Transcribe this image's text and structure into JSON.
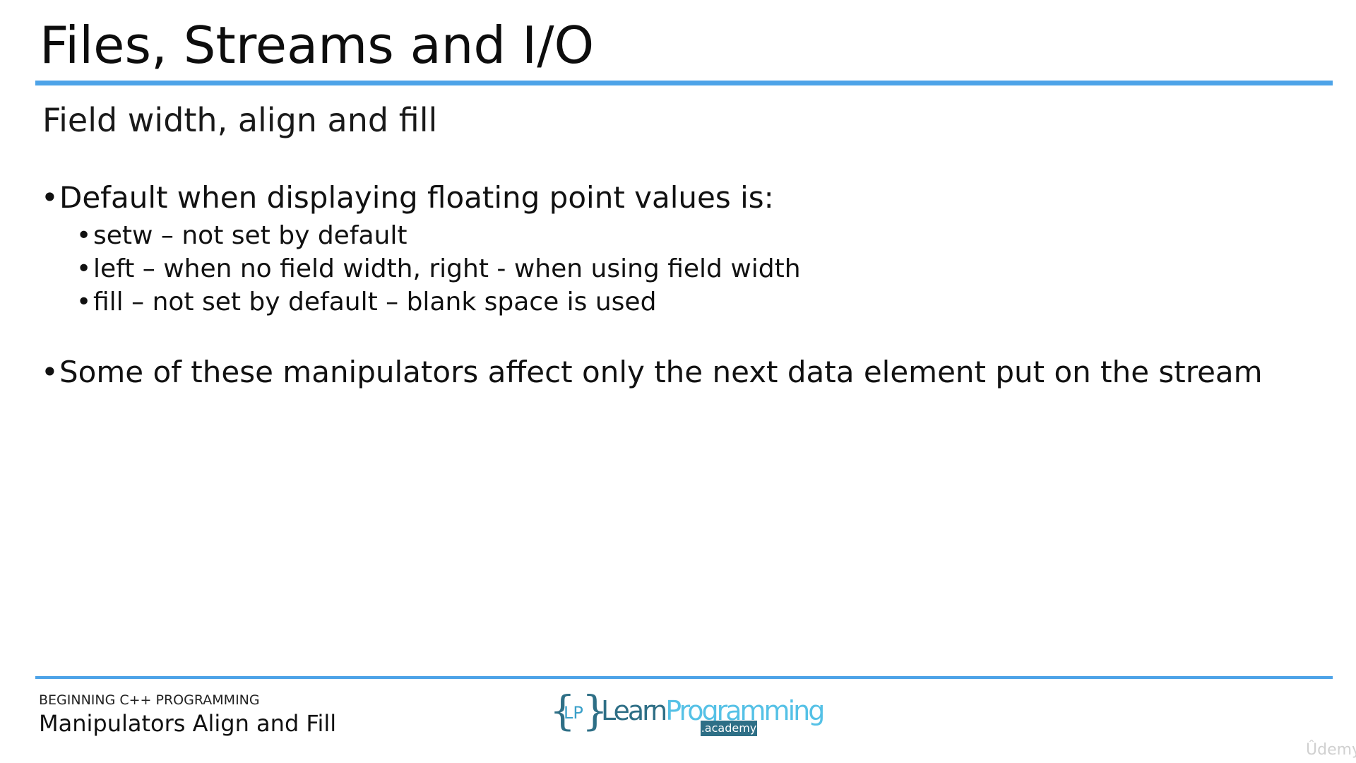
{
  "slide": {
    "title": "Files, Streams and I/O",
    "subtitle": "Field width, align and fill"
  },
  "bullets": [
    {
      "text": "Default when displaying floating point values is:",
      "sub_bullets": [
        "setw – not set by default",
        "left – when no field width, right - when using field width",
        "fill – not set by default – blank space is used"
      ]
    },
    {
      "text": "Some of these manipulators affect only the next data element put on the stream"
    }
  ],
  "bullet_symbol": "•",
  "footer": {
    "course": "BEGINNING C++ PROGRAMMING",
    "lecture": "Manipulators Align and Fill"
  },
  "logo": {
    "brace_left": "{",
    "brace_right": "}",
    "initials": "LP",
    "word_learn": "Learn",
    "word_programming": "Programming",
    "academy": ".academy"
  },
  "watermark": "Ûdemy",
  "colors": {
    "accent_rule": "#4da3e8",
    "logo_dark": "#2e6f86",
    "logo_light": "#55c1e6"
  }
}
